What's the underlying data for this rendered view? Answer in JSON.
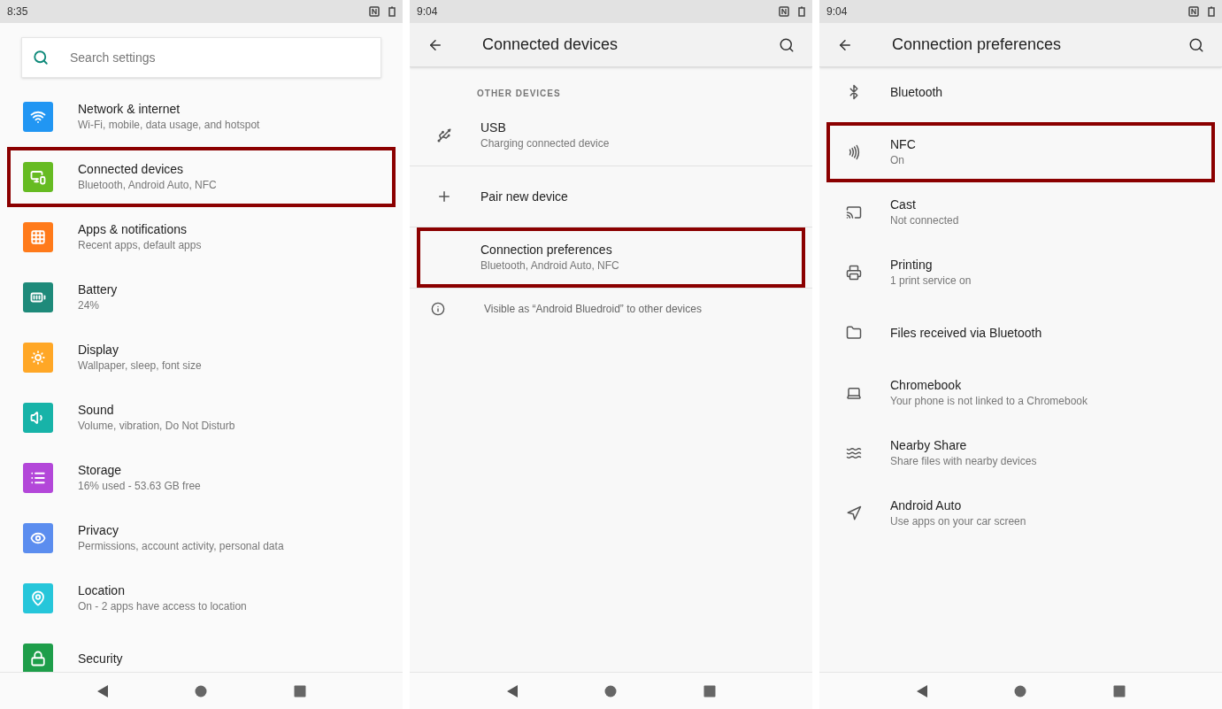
{
  "screens": [
    {
      "kind": "home",
      "status_bar": {
        "time": "8:35"
      },
      "search": {
        "placeholder": "Search settings"
      },
      "items": [
        {
          "title": "Network & internet",
          "subtitle": "Wi-Fi, mobile, data usage, and hotspot",
          "color": "#2196f3",
          "highlighted": false
        },
        {
          "title": "Connected devices",
          "subtitle": "Bluetooth, Android Auto, NFC",
          "color": "#66bb22",
          "highlighted": true
        },
        {
          "title": "Apps & notifications",
          "subtitle": "Recent apps, default apps",
          "color": "#ff7a1a",
          "highlighted": false
        },
        {
          "title": "Battery",
          "subtitle": "24%",
          "color": "#1e8a7a",
          "highlighted": false
        },
        {
          "title": "Display",
          "subtitle": "Wallpaper, sleep, font size",
          "color": "#ffa726",
          "highlighted": false
        },
        {
          "title": "Sound",
          "subtitle": "Volume, vibration, Do Not Disturb",
          "color": "#17b3a8",
          "highlighted": false
        },
        {
          "title": "Storage",
          "subtitle": "16% used - 53.63 GB free",
          "color": "#b347d9",
          "highlighted": false
        },
        {
          "title": "Privacy",
          "subtitle": "Permissions, account activity, personal data",
          "color": "#5b8def",
          "highlighted": false
        },
        {
          "title": "Location",
          "subtitle": "On - 2 apps have access to location",
          "color": "#26c6da",
          "highlighted": false
        },
        {
          "title": "Security",
          "color": "#1e9e4a",
          "highlighted": false
        }
      ]
    },
    {
      "kind": "detail",
      "status_bar": {
        "time": "9:04"
      },
      "title": "Connected devices",
      "section": "OTHER DEVICES",
      "items": [
        {
          "title": "USB",
          "subtitle": "Charging connected device",
          "highlighted": false
        },
        {
          "title": "Pair new device",
          "highlighted": false
        },
        {
          "title": "Connection preferences",
          "subtitle": "Bluetooth, Android Auto, NFC",
          "highlighted": true
        }
      ],
      "footer": "Visible as “Android Bluedroid” to other devices"
    },
    {
      "kind": "detail",
      "status_bar": {
        "time": "9:04"
      },
      "title": "Connection preferences",
      "items": [
        {
          "title": "Bluetooth",
          "highlighted": false
        },
        {
          "title": "NFC",
          "subtitle": "On",
          "highlighted": true
        },
        {
          "title": "Cast",
          "subtitle": "Not connected",
          "highlighted": false
        },
        {
          "title": "Printing",
          "subtitle": "1 print service on",
          "highlighted": false
        },
        {
          "title": "Files received via Bluetooth",
          "highlighted": false
        },
        {
          "title": "Chromebook",
          "subtitle": "Your phone is not linked to a Chromebook",
          "highlighted": false
        },
        {
          "title": "Nearby Share",
          "subtitle": "Share files with nearby devices",
          "highlighted": false
        },
        {
          "title": "Android Auto",
          "subtitle": "Use apps on your car screen",
          "highlighted": false
        }
      ]
    }
  ]
}
